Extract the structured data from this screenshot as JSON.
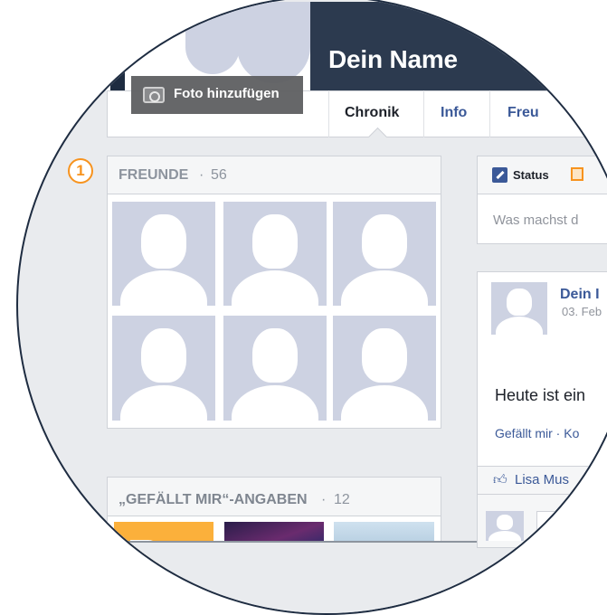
{
  "profile": {
    "name": "Dein Name",
    "photo_button": "Foto hinzufügen"
  },
  "tabs": [
    "Chronik",
    "Info",
    "Freu"
  ],
  "friends": {
    "marker": "1",
    "title": "FREUNDE",
    "separator": " · ",
    "count": "56"
  },
  "likes": {
    "title": "„GEFÄLLT MIR“-ANGABEN",
    "separator": " · ",
    "count": "12"
  },
  "composer": {
    "status_label": "Status",
    "placeholder": "Was machst d"
  },
  "post": {
    "author": "Dein I",
    "date": "03. Feb",
    "text": "Heute ist ein",
    "actions": "Gefällt mir · Ko",
    "liked_by": "Lisa Mus"
  },
  "colors": {
    "header_dark": "#2c3a4f",
    "link": "#3b5998",
    "accent_orange": "#f7931e",
    "placeholder_silhouette": "#cdd2e2"
  },
  "icons": [
    "camera-icon",
    "status-pencil-icon",
    "photo-tab-icon",
    "thumbs-up-icon"
  ]
}
